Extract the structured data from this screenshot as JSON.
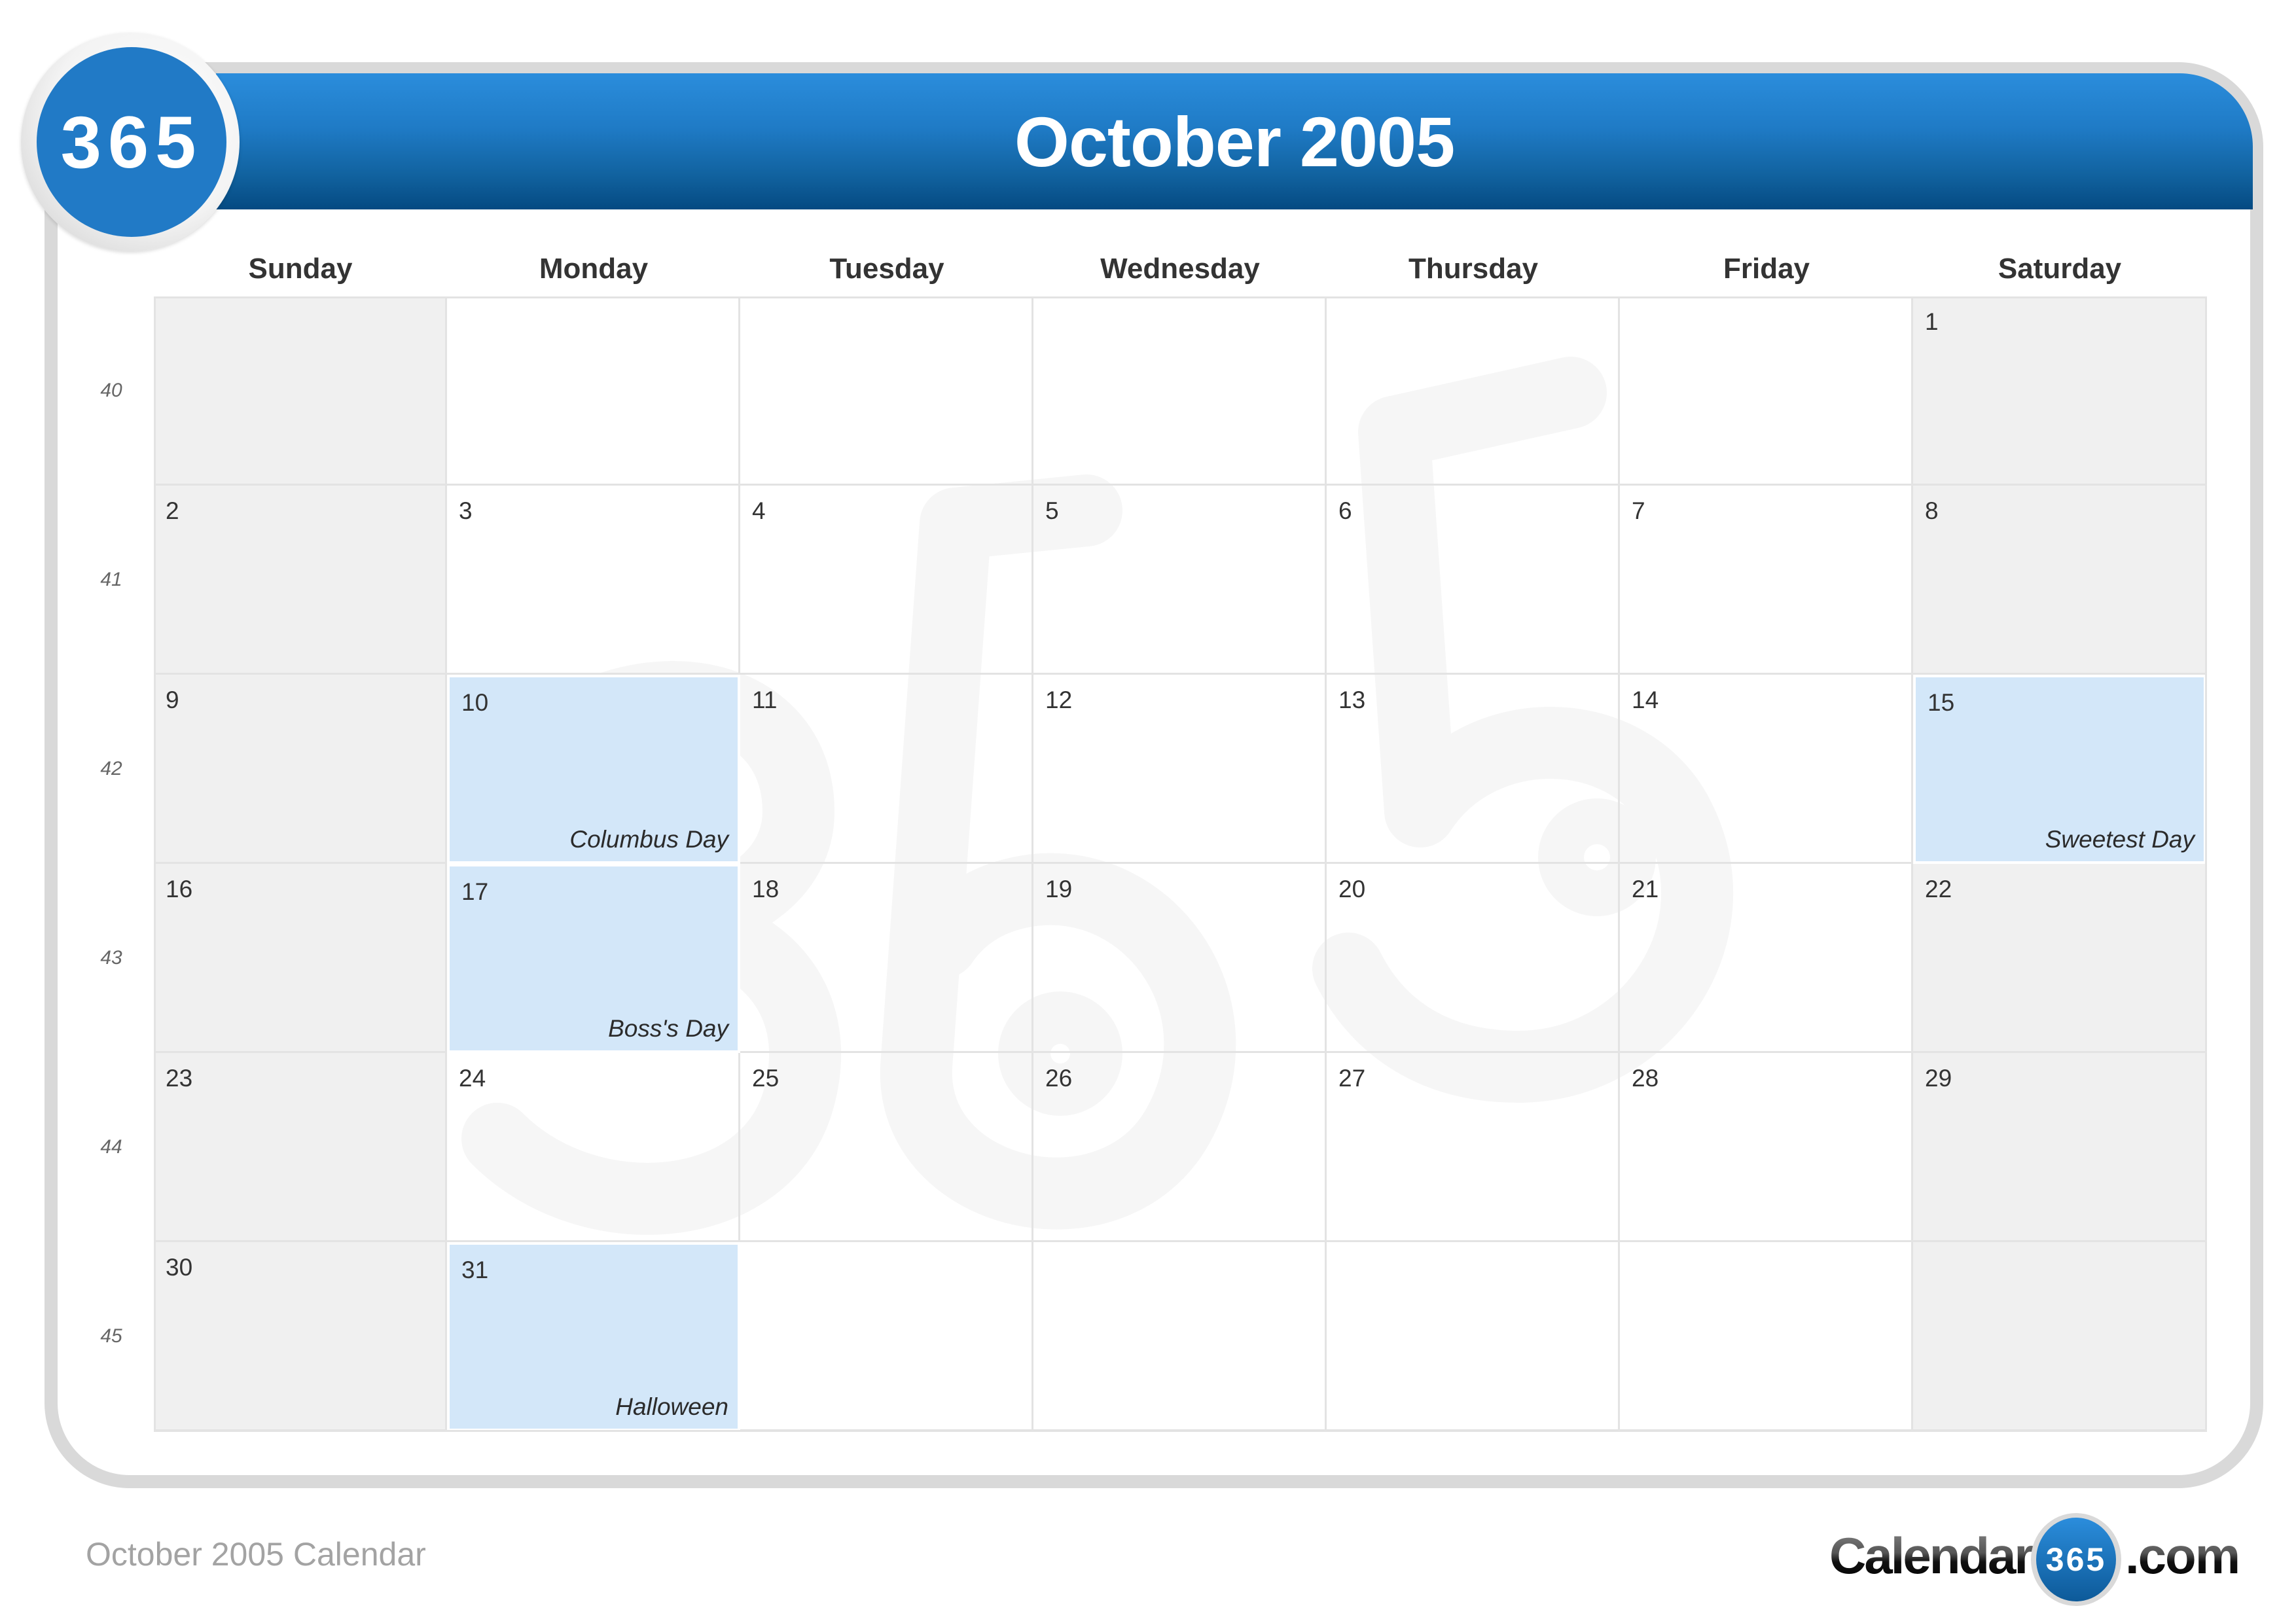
{
  "header": {
    "logo_text": "365",
    "title": "October 2005"
  },
  "weekdays": [
    "Sunday",
    "Monday",
    "Tuesday",
    "Wednesday",
    "Thursday",
    "Friday",
    "Saturday"
  ],
  "weeks": [
    {
      "week_number": "40",
      "days": [
        {
          "day": "",
          "weekend": true
        },
        {
          "day": ""
        },
        {
          "day": ""
        },
        {
          "day": ""
        },
        {
          "day": ""
        },
        {
          "day": ""
        },
        {
          "day": "1",
          "weekend": true
        }
      ]
    },
    {
      "week_number": "41",
      "days": [
        {
          "day": "2",
          "weekend": true
        },
        {
          "day": "3"
        },
        {
          "day": "4"
        },
        {
          "day": "5"
        },
        {
          "day": "6"
        },
        {
          "day": "7"
        },
        {
          "day": "8",
          "weekend": true
        }
      ]
    },
    {
      "week_number": "42",
      "days": [
        {
          "day": "9",
          "weekend": true
        },
        {
          "day": "10",
          "holiday": "Columbus Day"
        },
        {
          "day": "11"
        },
        {
          "day": "12"
        },
        {
          "day": "13"
        },
        {
          "day": "14"
        },
        {
          "day": "15",
          "holiday": "Sweetest Day"
        }
      ]
    },
    {
      "week_number": "43",
      "days": [
        {
          "day": "16",
          "weekend": true
        },
        {
          "day": "17",
          "holiday": "Boss's Day"
        },
        {
          "day": "18"
        },
        {
          "day": "19"
        },
        {
          "day": "20"
        },
        {
          "day": "21"
        },
        {
          "day": "22",
          "weekend": true
        }
      ]
    },
    {
      "week_number": "44",
      "days": [
        {
          "day": "23",
          "weekend": true
        },
        {
          "day": "24"
        },
        {
          "day": "25"
        },
        {
          "day": "26"
        },
        {
          "day": "27"
        },
        {
          "day": "28"
        },
        {
          "day": "29",
          "weekend": true
        }
      ]
    },
    {
      "week_number": "45",
      "days": [
        {
          "day": "30",
          "weekend": true
        },
        {
          "day": "31",
          "holiday": "Halloween"
        },
        {
          "day": ""
        },
        {
          "day": ""
        },
        {
          "day": ""
        },
        {
          "day": ""
        },
        {
          "day": "",
          "weekend": true
        }
      ]
    }
  ],
  "footer": {
    "caption": "October 2005 Calendar",
    "brand_left": "Calendar-",
    "brand_badge": "365",
    "brand_right": ".com"
  },
  "colors": {
    "header_blue_top": "#2b8ddc",
    "header_blue_bottom": "#054a82",
    "holiday_fill": "#d3e7f9",
    "weekend_fill": "#f0f0f0",
    "frame_gray": "#d9d9d9"
  }
}
